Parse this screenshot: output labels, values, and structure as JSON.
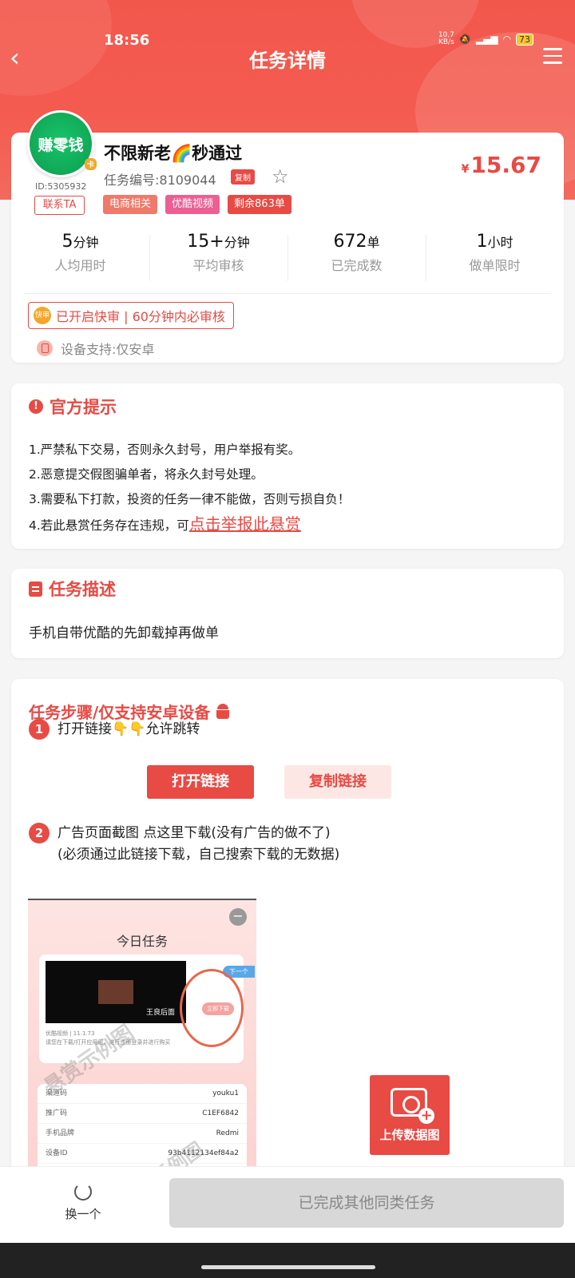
{
  "status_bar": {
    "time": "18:56",
    "net_speed_top": "10.7",
    "net_speed_bottom": "KB/s",
    "battery": "73"
  },
  "header": {
    "title": "任务详情"
  },
  "task": {
    "logo_text": "赚零钱",
    "logo_badge": "卡",
    "user_id": "ID:5305932",
    "contact_label": "联系TA",
    "title": "不限新老🌈秒通过",
    "task_number": "任务编号:8109044",
    "copy_label": "复制",
    "price_symbol": "¥",
    "price": "15.67",
    "tags": [
      "电商相关",
      "优酷视频",
      "剩余863单"
    ],
    "stats": [
      {
        "value": "5",
        "unit": "分钟",
        "label": "人均用时"
      },
      {
        "value": "15+",
        "unit": "分钟",
        "label": "平均审核"
      },
      {
        "value": "672",
        "unit": "单",
        "label": "已完成数"
      },
      {
        "value": "1",
        "unit": "小时",
        "label": "做单限时"
      }
    ],
    "fast_badge": "快审",
    "fast_review": "已开启快审 | 60分钟内必审核",
    "device_support": "设备支持:仅安卓"
  },
  "official_tips": {
    "heading": "官方提示",
    "rules": [
      "1.严禁私下交易，否则永久封号，用户举报有奖。",
      "2.恶意提交假图骗单者，将永久封号处理。",
      "3.需要私下打款，投资的任务一律不能做，否则亏损自负！",
      "4.若此悬赏任务存在违规，可"
    ],
    "report_link": "点击举报此悬赏"
  },
  "task_description": {
    "heading": "任务描述",
    "text": "手机自带优酷的先卸载掉再做单"
  },
  "steps": {
    "heading": "任务步骤/仅支持安卓设备",
    "step1": {
      "num": "1",
      "text": "打开链接👇👇允许跳转",
      "open_btn": "打开链接",
      "copy_btn": "复制链接"
    },
    "step2": {
      "num": "2",
      "line1": "广告页面截图  点这里下载(没有广告的做不了)",
      "line2": "(必须通过此链接下载，自己搜索下载的无数据)"
    },
    "example": {
      "title": "今日任务",
      "next_tag": "下一个",
      "download_btn": "立即下载",
      "video_caption": "王良后面",
      "meta1": "优酷视频 | 11.1.73",
      "meta2": "请您在下载/打开应用后，进行注册登录并进行购买",
      "watermark": "悬赏示例图",
      "watermark2": "示例图",
      "rows": [
        {
          "k": "渠道码",
          "v": "youku1"
        },
        {
          "k": "推广码",
          "v": "C1EF6842"
        },
        {
          "k": "手机品牌",
          "v": "Redmi"
        },
        {
          "k": "设备ID",
          "v": "93b4112134ef84a2"
        }
      ]
    },
    "upload_label": "上传数据图"
  },
  "bottom": {
    "swap_label": "换一个",
    "done_label": "已完成其他同类任务"
  }
}
